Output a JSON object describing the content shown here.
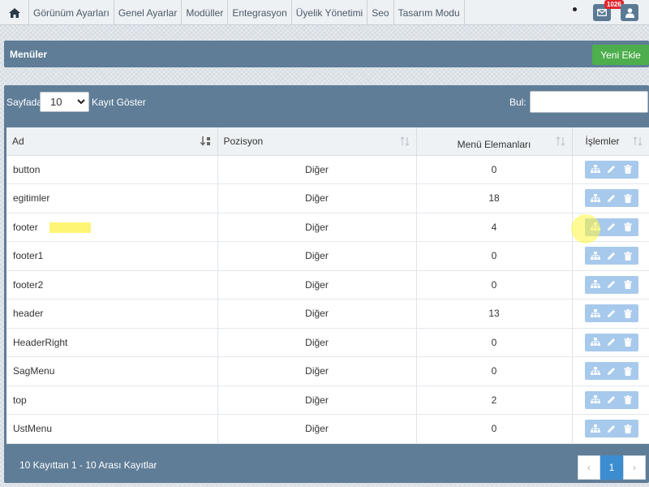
{
  "nav": {
    "home_icon": "home-icon",
    "items": [
      "Görünüm Ayarları",
      "Genel Ayarlar",
      "Modüller",
      "Entegrasyon",
      "Üyelik Yönetimi",
      "Seo",
      "Tasarım Modu"
    ],
    "mail_badge": "1026",
    "mail_icon": "envelope-icon",
    "user_icon": "user-icon"
  },
  "header": {
    "title": "Menüler",
    "new_button": "Yeni Ekle"
  },
  "controls": {
    "page_size_label": "Sayfada",
    "page_size_value": "10",
    "page_size_suffix": "Kayıt Göster",
    "search_label": "Bul:",
    "search_value": ""
  },
  "table": {
    "columns": [
      "Ad",
      "Pozisyon",
      "Menü Elemanları",
      "İşlemler"
    ],
    "rows": [
      {
        "ad": "button",
        "pozisyon": "Diğer",
        "elemanlar": "0"
      },
      {
        "ad": "egitimler",
        "pozisyon": "Diğer",
        "elemanlar": "18"
      },
      {
        "ad": "footer",
        "pozisyon": "Diğer",
        "elemanlar": "4"
      },
      {
        "ad": "footer1",
        "pozisyon": "Diğer",
        "elemanlar": "0"
      },
      {
        "ad": "footer2",
        "pozisyon": "Diğer",
        "elemanlar": "0"
      },
      {
        "ad": "header",
        "pozisyon": "Diğer",
        "elemanlar": "13"
      },
      {
        "ad": "HeaderRight",
        "pozisyon": "Diğer",
        "elemanlar": "0"
      },
      {
        "ad": "SagMenu",
        "pozisyon": "Diğer",
        "elemanlar": "0"
      },
      {
        "ad": "top",
        "pozisyon": "Diğer",
        "elemanlar": "2"
      },
      {
        "ad": "UstMenu",
        "pozisyon": "Diğer",
        "elemanlar": "0"
      }
    ],
    "action_icons": [
      "sitemap-icon",
      "pencil-icon",
      "trash-icon"
    ]
  },
  "footer": {
    "info": "10 Kayıttan 1 - 10 Arası Kayıtlar",
    "prev": "‹",
    "current_page": "1",
    "next": "›"
  },
  "colors": {
    "panel": "#5f7d97",
    "success": "#4cae4c",
    "action_button": "#a7c9ec",
    "page_active": "#3c8dd0",
    "badge": "#e0262f"
  }
}
